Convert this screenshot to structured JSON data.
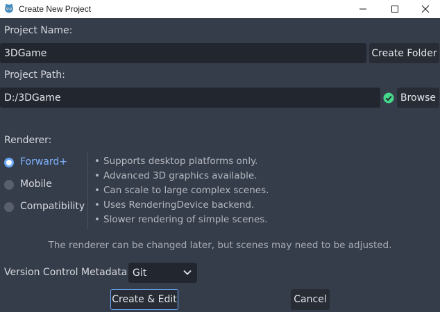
{
  "window": {
    "title": "Create New Project"
  },
  "project_name": {
    "label": "Project Name:",
    "value": "3DGame",
    "create_folder_label": "Create Folder"
  },
  "project_path": {
    "label": "Project Path:",
    "value": "D:/3DGame",
    "browse_label": "Browse",
    "status_icon": "check-circle-icon"
  },
  "renderer": {
    "label": "Renderer:",
    "options": [
      {
        "label": "Forward+",
        "selected": true
      },
      {
        "label": "Mobile",
        "selected": false
      },
      {
        "label": "Compatibility",
        "selected": false
      }
    ],
    "features": [
      "Supports desktop platforms only.",
      "Advanced 3D graphics available.",
      "Can scale to large complex scenes.",
      "Uses RenderingDevice backend.",
      "Slower rendering of simple scenes."
    ],
    "notice": "The renderer can be changed later, but scenes may need to be adjusted."
  },
  "vcs": {
    "label": "Version Control Metadata:",
    "value": "Git"
  },
  "actions": {
    "create_label": "Create & Edit",
    "cancel_label": "Cancel"
  },
  "colors": {
    "background": "#363d4a",
    "field": "#22262e",
    "accent": "#6aa7f8",
    "success": "#45d98a"
  }
}
